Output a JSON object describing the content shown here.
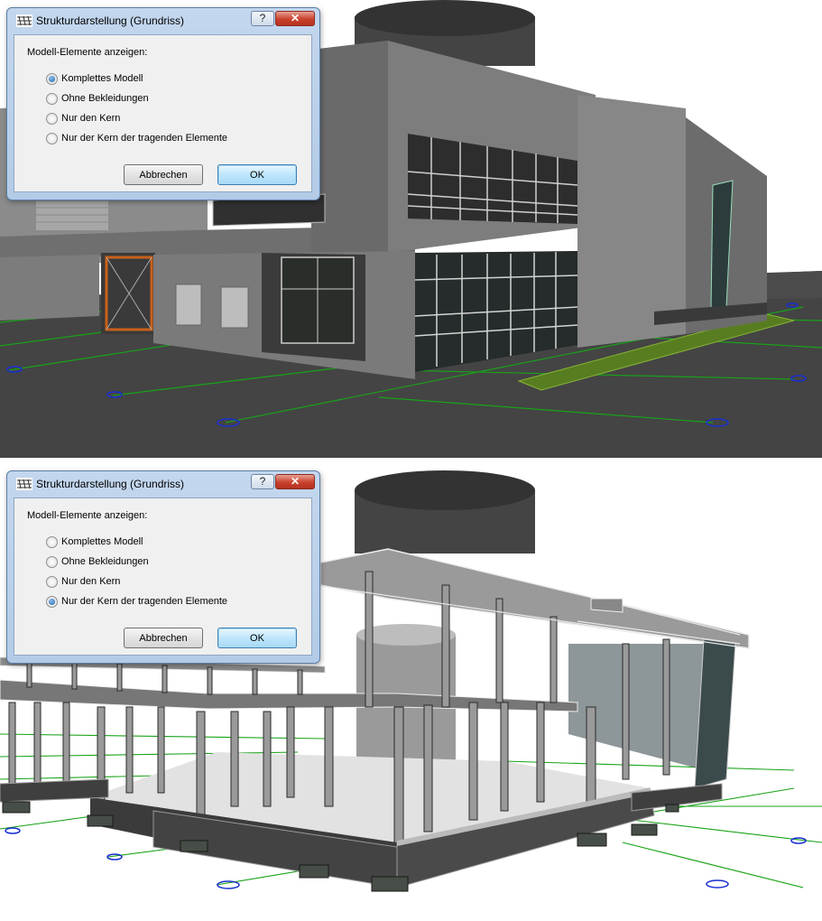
{
  "screens": [
    {
      "dialog": {
        "title": "Strukturdarstellung (Grundriss)",
        "help_label": "?",
        "close_label": "✕",
        "group_label": "Modell-Elemente anzeigen:",
        "options": [
          {
            "label": "Komplettes Modell",
            "checked": true
          },
          {
            "label": "Ohne Bekleidungen",
            "checked": false
          },
          {
            "label": "Nur den Kern",
            "checked": false
          },
          {
            "label": "Nur der Kern der tragenden Elemente",
            "checked": false
          }
        ],
        "cancel_label": "Abbrechen",
        "ok_label": "OK"
      },
      "viewport": {
        "mode": "full-building-model"
      }
    },
    {
      "dialog": {
        "title": "Strukturdarstellung (Grundriss)",
        "help_label": "?",
        "close_label": "✕",
        "group_label": "Modell-Elemente anzeigen:",
        "options": [
          {
            "label": "Komplettes Modell",
            "checked": false
          },
          {
            "label": "Ohne Bekleidungen",
            "checked": false
          },
          {
            "label": "Nur den Kern",
            "checked": false
          },
          {
            "label": "Nur der Kern der tragenden Elemente",
            "checked": true
          }
        ],
        "cancel_label": "Abbrechen",
        "ok_label": "OK"
      },
      "viewport": {
        "mode": "load-bearing-core-structure"
      }
    }
  ],
  "colors": {
    "grid_line": "#19a319",
    "grid_marker": "#1a2fd0",
    "ground": "#464646",
    "sky": "#ffffff"
  }
}
